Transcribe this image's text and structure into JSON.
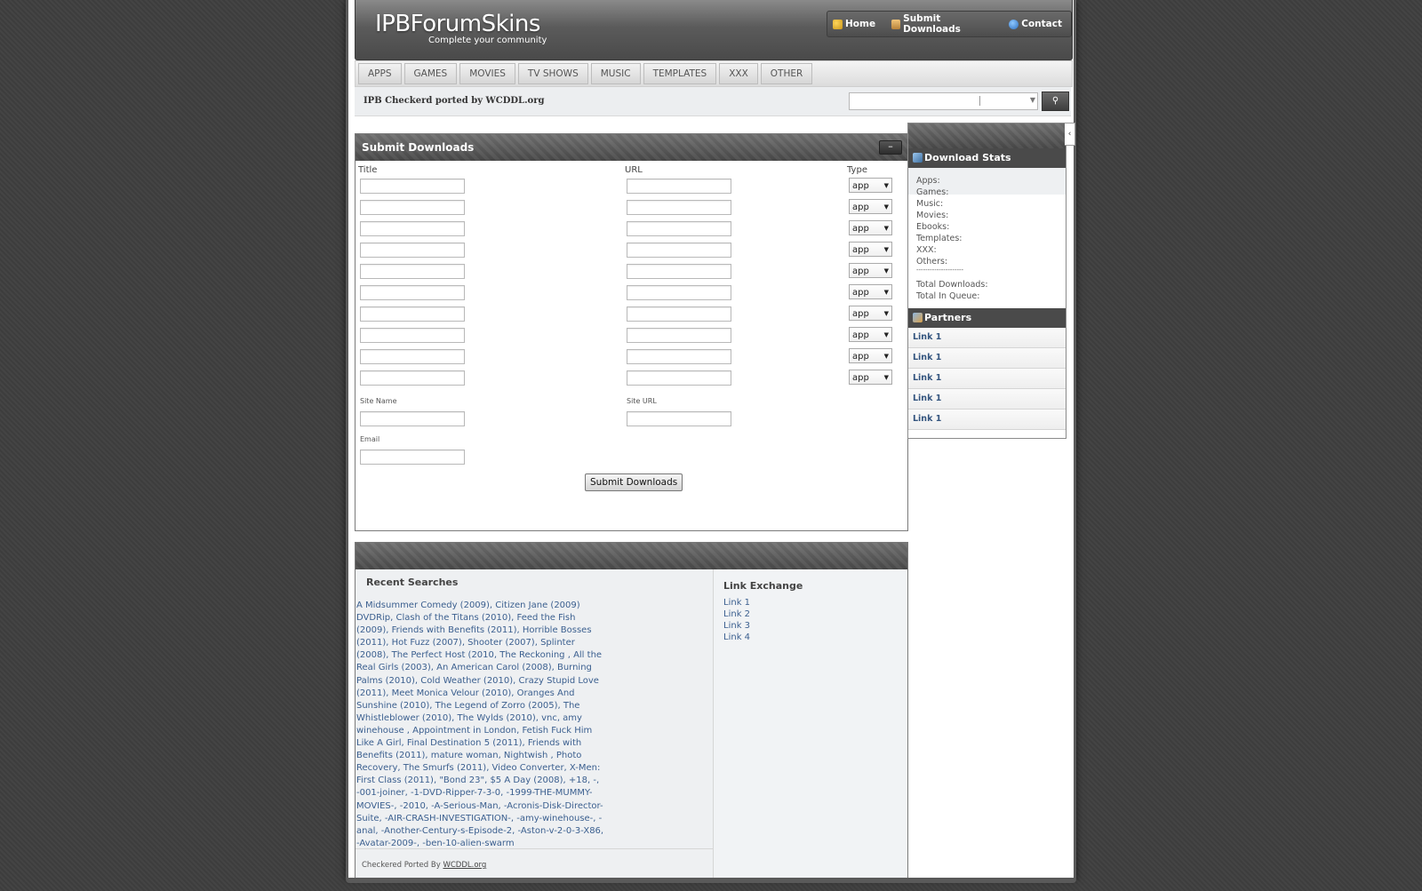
{
  "header": {
    "logo_title": "IPBForumSkins",
    "logo_tagline": "Complete your community",
    "nav": [
      {
        "label": "Home",
        "icon": "key-icon"
      },
      {
        "label": "Submit Downloads",
        "icon": "package-icon"
      },
      {
        "label": "Contact",
        "icon": "help-icon"
      }
    ]
  },
  "categories": [
    "APPS",
    "GAMES",
    "MOVIES",
    "TV SHOWS",
    "MUSIC",
    "TEMPLATES",
    "XXX",
    "OTHER"
  ],
  "subbar": {
    "text": "IPB Checkerd ported by WCDDL.org"
  },
  "submit": {
    "title": "Submit Downloads",
    "collapse_label": "–",
    "col_title": "Title",
    "col_url": "URL",
    "col_type": "Type",
    "type_value": "app",
    "row_count": 10,
    "site_name_label": "Site Name",
    "site_url_label": "Site URL",
    "email_label": "Email",
    "button_label": "Submit Downloads"
  },
  "recent": {
    "title": "Recent Searches",
    "text": "A Midsummer Comedy (2009), Citizen Jane (2009) DVDRip, Clash of the Titans (2010), Feed the Fish (2009), Friends with Benefits (2011), Horrible Bosses (2011), Hot Fuzz (2007), Shooter (2007), Splinter (2008), The Perfect Host (2010, The Reckoning , All the Real Girls (2003), An American Carol (2008), Burning Palms (2010), Cold Weather (2010), Crazy Stupid Love (2011), Meet Monica Velour (2010), Oranges And Sunshine (2010), The Legend of Zorro (2005), The Whistleblower (2010), The Wylds (2010), vnc, amy winehouse , Appointment in London, Fetish Fuck Him Like A Girl, Final Destination 5 (2011), Friends with Benefits (2011), mature woman, Nightwish , Photo Recovery, The Smurfs (2011), Video Converter, X-Men: First Class (2011), \"Bond 23\", $5 A Day (2008), +18, -, -001-joiner, -1-DVD-Ripper-7-3-0, -1999-THE-MUMMY-MOVIES-, -2010, -A-Serious-Man, -Acronis-Disk-Director-Suite, -AIR-CRASH-INVESTIGATION-, -amy-winehouse-, -anal, -Another-Century-s-Episode-2, -Aston-v-2-0-3-X86, -Avatar-2009-, -ben-10-alien-swarm",
    "footer_prefix": "Checkered Ported By",
    "footer_link": "WCDDL.org"
  },
  "link_exchange": {
    "title": "Link Exchange",
    "links": [
      "Link 1",
      "Link 2",
      "Link 3",
      "Link 4"
    ]
  },
  "sidebar": {
    "toggle": "‹",
    "stats_title": "Download Stats",
    "stats": [
      "Apps:",
      "Games:",
      "Music:",
      "Movies:",
      "Ebooks:",
      "Templates:",
      "XXX:",
      "Others:",
      "---------------------",
      "Total Downloads:",
      "Total In Queue:"
    ],
    "partners_title": "Partners",
    "partners": [
      "Link 1",
      "Link 1",
      "Link 1",
      "Link 1",
      "Link 1"
    ]
  },
  "colors": {
    "header_dark": "#4a4a4a",
    "link_blue": "#3b5f8f",
    "background": "#3f3f3f"
  }
}
